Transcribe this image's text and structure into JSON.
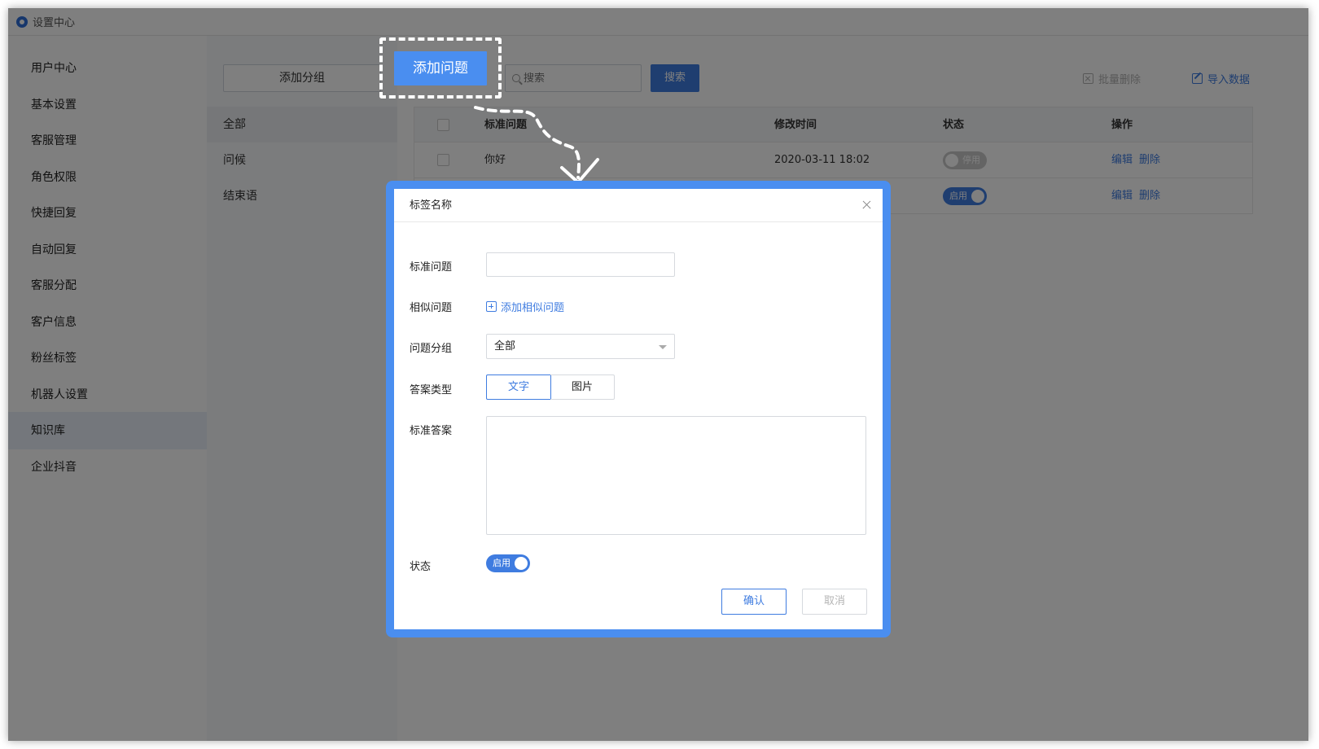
{
  "window": {
    "title": "设置中心"
  },
  "sidebar": {
    "items": [
      {
        "label": "用户中心"
      },
      {
        "label": "基本设置"
      },
      {
        "label": "客服管理"
      },
      {
        "label": "角色权限"
      },
      {
        "label": "快捷回复"
      },
      {
        "label": "自动回复"
      },
      {
        "label": "客服分配"
      },
      {
        "label": "客户信息"
      },
      {
        "label": "粉丝标签"
      },
      {
        "label": "机器人设置"
      },
      {
        "label": "知识库",
        "active": true
      },
      {
        "label": "企业抖音"
      }
    ]
  },
  "groups": {
    "add_label": "添加分组",
    "items": [
      {
        "label": "全部",
        "active": true
      },
      {
        "label": "问候"
      },
      {
        "label": "结束语"
      }
    ]
  },
  "toolbar": {
    "add_question_label": "添加问题",
    "search_placeholder": "搜索",
    "search_button": "搜索",
    "batch_delete": "批量删除",
    "import_data": "导入数据"
  },
  "table": {
    "headers": {
      "question": "标准问题",
      "time": "修改时间",
      "status": "状态",
      "ops": "操作"
    },
    "rows": [
      {
        "question": "你好",
        "time": "2020-03-11 18:02",
        "status": "停用",
        "edit": "编辑",
        "delete": "删除"
      },
      {
        "question": "",
        "time": "",
        "status": "启用",
        "edit": "编辑",
        "delete": "删除"
      }
    ]
  },
  "dialog": {
    "title": "标签名称",
    "std_question_label": "标准问题",
    "std_question_value": "",
    "similar_label": "相似问题",
    "add_similar": "添加相似问题",
    "group_label": "问题分组",
    "group_value": "全部",
    "answer_type_label": "答案类型",
    "answer_type_text": "文字",
    "answer_type_image": "图片",
    "std_answer_label": "标准答案",
    "std_answer_value": "",
    "status_label": "状态",
    "status_value": "启用",
    "confirm": "确认",
    "cancel": "取消"
  },
  "colors": {
    "accent": "#3f7ce0",
    "highlight": "#4a8ef0",
    "overlay": "rgba(0,0,0,0.5)"
  }
}
